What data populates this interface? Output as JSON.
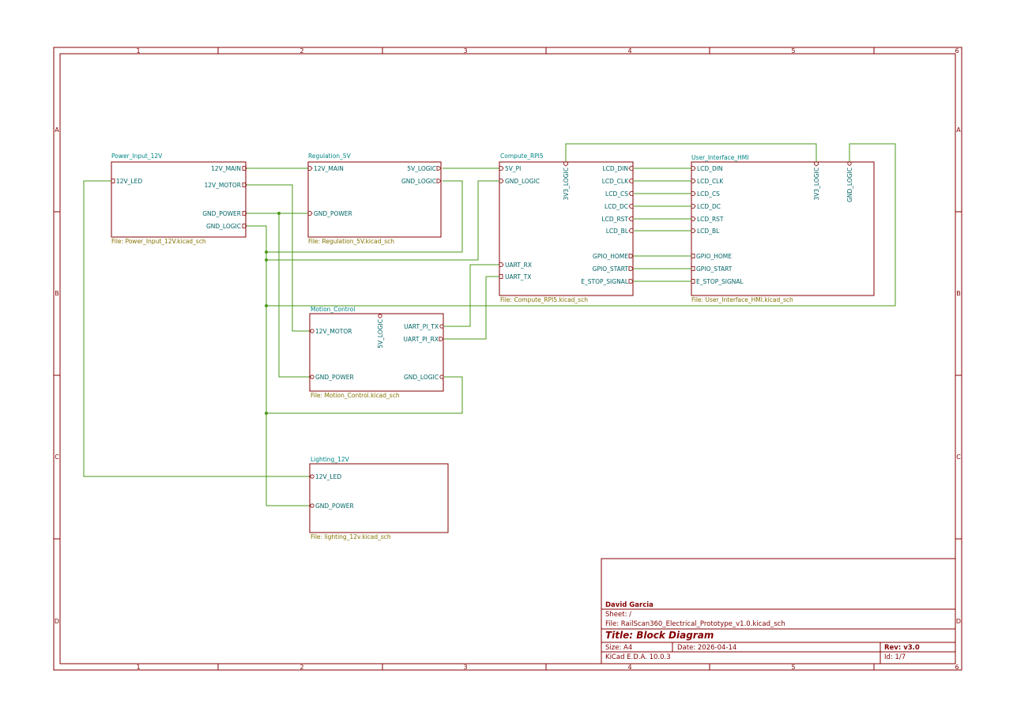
{
  "zones": {
    "columns": [
      "1",
      "2",
      "3",
      "4",
      "5",
      "6"
    ],
    "rows": [
      "A",
      "B",
      "C",
      "D"
    ]
  },
  "sheets": {
    "power": {
      "name": "Power_Input_12V",
      "file": "File: Power_Input_12V.kicad_sch",
      "pins": [
        "12V_MAIN",
        "12V_MOTOR",
        "GND_POWER",
        "GND_LOGIC",
        "12V_LED"
      ]
    },
    "regulation": {
      "name": "Regulation_5V",
      "file": "File: Regulation_5V.kicad_sch",
      "pins": [
        "12V_MAIN",
        "GND_POWER",
        "5V_LOGIC",
        "GND_LOGIC"
      ]
    },
    "compute": {
      "name": "Compute_RPI5",
      "file": "File: Compute_RPI5.kicad_sch",
      "pins": [
        "5V_PI",
        "GND_LOGIC",
        "UART_RX",
        "UART_TX",
        "3V3_LOGIC",
        "LCD_DIN",
        "LCD_CLK",
        "LCD_CS",
        "LCD_DC",
        "LCD_RST",
        "LCD_BL",
        "GPIO_HOME",
        "GPIO_START",
        "E_STOP_SIGNAL"
      ]
    },
    "ui": {
      "name": "User_Interface_HMI",
      "file": "File: User_Interface_HMI.kicad_sch",
      "pins": [
        "LCD_DIN",
        "LCD_CLK",
        "LCD_CS",
        "LCD_DC",
        "LCD_RST",
        "LCD_BL",
        "GPIO_HOME",
        "GPIO_START",
        "E_STOP_SIGNAL",
        "3V3_LOGIC",
        "GND_LOGIC"
      ]
    },
    "motion": {
      "name": "Motion_Control",
      "file": "File: Motion_Control.kicad_sch",
      "pins": [
        "12V_MOTOR",
        "GND_POWER",
        "5V_LOGIC",
        "UART_PI_TX",
        "UART_PI_RX",
        "GND_LOGIC"
      ]
    },
    "lighting": {
      "name": "Lighting_12V",
      "file": "File: lighting_12v.kicad_sch",
      "pins": [
        "12V_LED",
        "GND_POWER"
      ]
    }
  },
  "title_block": {
    "company": "David Garcia",
    "sheet": "Sheet: /",
    "file": "File: RailScan360_Electrical_Prototype_v1.0.kicad_sch",
    "title": "Title: Block Diagram",
    "size": "Size: A4",
    "date": "Date: 2026-04-14",
    "rev": "Rev: v3.0",
    "tool": "KiCad E.D.A. 10.0.3",
    "id": "Id: 1/7"
  },
  "colors": {
    "frame": "#840000",
    "wire": "#4a9a1a",
    "pin_text": "#006464",
    "sheet_name": "#008484",
    "sheet_file": "#847200"
  }
}
